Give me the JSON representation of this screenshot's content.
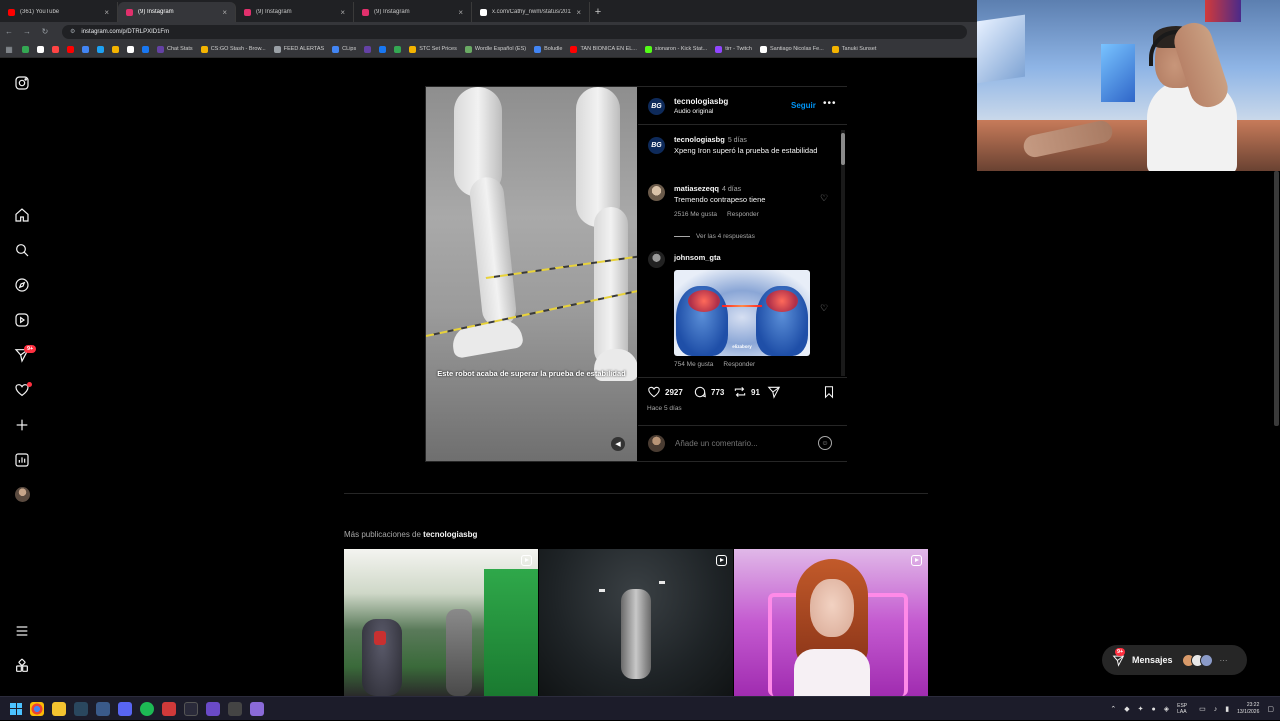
{
  "browser": {
    "tabs": [
      {
        "title": "(361) YouTube",
        "color": "#ff0000",
        "active": false
      },
      {
        "title": "(9) Instagram",
        "color": "#e1306c",
        "active": true
      },
      {
        "title": "(9) Instagram",
        "color": "#e1306c",
        "active": false
      },
      {
        "title": "(9) Instagram",
        "color": "#e1306c",
        "active": false
      },
      {
        "title": "x.com/Cathy_nwm/status/2011",
        "color": "#ffffff",
        "active": false
      }
    ],
    "url": "instagram.com/p/DTRLPXID1Fm",
    "bookmarks": [
      {
        "label": "",
        "color": "#34a853"
      },
      {
        "label": "",
        "color": "#ffffff"
      },
      {
        "label": "",
        "color": "#ff4444"
      },
      {
        "label": "",
        "color": "#ff0000"
      },
      {
        "label": "",
        "color": "#4285f4"
      },
      {
        "label": "",
        "color": "#1da1f2"
      },
      {
        "label": "",
        "color": "#f4b400"
      },
      {
        "label": "",
        "color": "#ffffff"
      },
      {
        "label": "",
        "color": "#1877f2"
      },
      {
        "label": "Chat Stats",
        "color": "#6441a5"
      },
      {
        "label": "CS:GO Stash - Brow...",
        "color": "#f4b400"
      },
      {
        "label": "FEED ALERTAS",
        "color": "#9aa0a6"
      },
      {
        "label": "CLips",
        "color": "#4285f4"
      },
      {
        "label": "",
        "color": "#6441a5"
      },
      {
        "label": "",
        "color": "#1877f2"
      },
      {
        "label": "",
        "color": "#34a853"
      },
      {
        "label": "STC Set Prices",
        "color": "#f4b400"
      },
      {
        "label": "Wordle Español (ES)",
        "color": "#6aaa64"
      },
      {
        "label": "Boludle",
        "color": "#4285f4"
      },
      {
        "label": "TAN BIONICA EN EL...",
        "color": "#ff0000"
      },
      {
        "label": "sionaron - Kick Stat...",
        "color": "#53fc18"
      },
      {
        "label": "tirr - Twitch",
        "color": "#9146ff"
      },
      {
        "label": "Santiago Nicolas Fe...",
        "color": "#ffffff"
      },
      {
        "label": "Tanuki Sunset",
        "color": "#f4b400"
      }
    ]
  },
  "post": {
    "author": "tecnologiasbg",
    "logo_text": "BG",
    "audio": "Audio original",
    "follow_label": "Seguir",
    "more_icon": "•••",
    "video_caption": "Este robot acaba de superar la prueba de estabilidad",
    "caption": {
      "user": "tecnologiasbg",
      "time": "5 días",
      "text": "Xpeng Iron superó la prueba de estabilidad"
    },
    "comments": [
      {
        "user": "matiasezeqq",
        "time": "4 días",
        "text": "Tremendo contrapeso tiene",
        "likes": "2516 Me gusta",
        "reply": "Responder"
      },
      {
        "user": "johnsom_gta",
        "time": "",
        "text": "",
        "likes": "754 Me gusta",
        "reply": "Responder",
        "gif_tag": "elizabory"
      }
    ],
    "view_replies": "Ver las 4 respuestas",
    "like_count": "2927",
    "comment_count": "773",
    "repost_count": "91",
    "time_ago": "Hace 5 días",
    "comment_placeholder": "Añade un comentario..."
  },
  "more_posts": {
    "title_prefix": "Más publicaciones de",
    "title_user": "tecnologiasbg"
  },
  "messages": {
    "label": "Mensajes",
    "badge": "9+"
  },
  "notifications_badge": "9+",
  "taskbar": {
    "lang": "ESP LAA",
    "time": "23:22",
    "date": "13/1/2026"
  }
}
